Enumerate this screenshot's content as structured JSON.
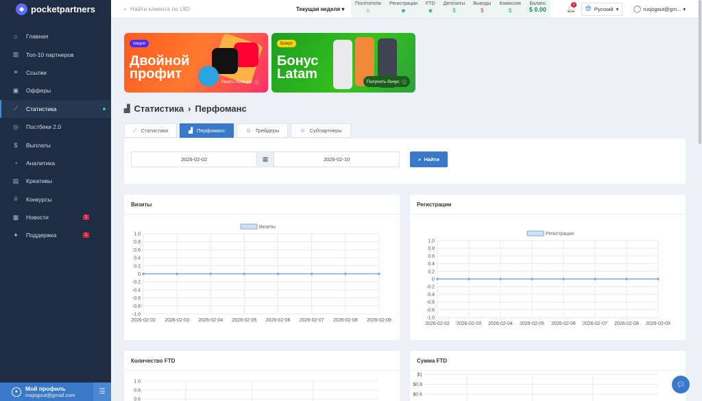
{
  "brand": {
    "name": "pocketpartners"
  },
  "topbar": {
    "search_placeholder": "Найти клиента по UID",
    "period": "Текущая неделя",
    "stats": [
      {
        "label": "Посетители",
        "value": "",
        "icon": "user-icon"
      },
      {
        "label": "Регистрации",
        "value": "",
        "icon": "users-icon"
      },
      {
        "label": "FTD",
        "value": "",
        "icon": "users-icon"
      },
      {
        "label": "Депозиты",
        "value": "$",
        "icon": "dollar-icon"
      },
      {
        "label": "Выводы",
        "value": "$",
        "icon": "dollar-icon"
      },
      {
        "label": "Комиссия",
        "value": "$",
        "icon": "dollar-icon"
      },
      {
        "label": "Баланс",
        "value": "$ 0.00",
        "icon": ""
      }
    ],
    "notifications_count": "2",
    "language": "Русский",
    "user_email": "rusjogout@gm..."
  },
  "sidebar": {
    "items": [
      {
        "label": "Главная",
        "icon": "home-icon",
        "active": false,
        "badge": ""
      },
      {
        "label": "Топ-10 партнеров",
        "icon": "bar-chart-icon",
        "active": false,
        "badge": ""
      },
      {
        "label": "Ссылки",
        "icon": "link-icon",
        "active": false,
        "badge": ""
      },
      {
        "label": "Офферы",
        "icon": "briefcase-icon",
        "active": false,
        "badge": ""
      },
      {
        "label": "Статистика",
        "icon": "line-chart-icon",
        "active": true,
        "badge": ""
      },
      {
        "label": "Постбеки 2.0",
        "icon": "globe-icon",
        "active": false,
        "badge": ""
      },
      {
        "label": "Выплаты",
        "icon": "dollar-icon",
        "active": false,
        "badge": ""
      },
      {
        "label": "Аналитика",
        "icon": "analytics-icon",
        "active": false,
        "badge": ""
      },
      {
        "label": "Креативы",
        "icon": "image-icon",
        "active": false,
        "badge": ""
      },
      {
        "label": "Конкурсы",
        "icon": "trophy-icon",
        "active": false,
        "badge": ""
      },
      {
        "label": "Новости",
        "icon": "news-icon",
        "active": false,
        "badge": "1"
      },
      {
        "label": "Поддержка",
        "icon": "support-icon",
        "active": false,
        "badge": "1"
      }
    ],
    "profile": {
      "title": "Мой профиль",
      "email": "rusjogout@gmail.com"
    }
  },
  "banners": [
    {
      "tag": "Акция",
      "title_line1": "Двойной",
      "title_line2": "профит",
      "button": "Узнать больше"
    },
    {
      "tag": "Бонус",
      "title_line1": "Бонус",
      "title_line2": "Latam",
      "button": "Получить бонус"
    }
  ],
  "page": {
    "title": "Статистика",
    "subtitle": "Перфоманс"
  },
  "tabs": [
    {
      "label": "Статистика",
      "icon": "chart-icon",
      "active": false
    },
    {
      "label": "Перфоманс",
      "icon": "area-chart-icon",
      "active": true
    },
    {
      "label": "Трейдеры",
      "icon": "user-icon",
      "active": false
    },
    {
      "label": "Субпартнеры",
      "icon": "user-icon",
      "active": false
    }
  ],
  "filter": {
    "date_from": "2026-02-02",
    "date_to": "2026-02-10",
    "find_button": "Найти"
  },
  "chart_data": [
    {
      "type": "line",
      "title": "Визиты",
      "categories": [
        "2026-02-02",
        "2026-02-03",
        "2026-02-04",
        "2026-02-05",
        "2026-02-06",
        "2026-02-07",
        "2026-02-08",
        "2026-02-09"
      ],
      "series": [
        {
          "name": "Визиты",
          "values": [
            0,
            0,
            0,
            0,
            0,
            0,
            0,
            0
          ]
        }
      ],
      "ylim": [
        -1.0,
        1.0
      ],
      "yticks": [
        "1.0",
        "0.8",
        "0.6",
        "0.4",
        "0.2",
        "0",
        "-0.2",
        "-0.4",
        "-0.6",
        "-0.8",
        "-1.0"
      ],
      "grid": true,
      "legend": "top"
    },
    {
      "type": "line",
      "title": "Регистрации",
      "categories": [
        "2026-02-02",
        "2026-02-03",
        "2026-02-04",
        "2026-02-05",
        "2026-02-06",
        "2026-02-07",
        "2026-02-08",
        "2026-02-09"
      ],
      "series": [
        {
          "name": "Регистрации",
          "values": [
            0,
            0,
            0,
            0,
            0,
            0,
            0,
            0
          ]
        }
      ],
      "ylim": [
        -1.0,
        1.0
      ],
      "yticks": [
        "1.0",
        "0.8",
        "0.6",
        "0.4",
        "0.2",
        "0",
        "-0.2",
        "-0.4",
        "-0.6",
        "-0.8",
        "-1.0"
      ],
      "grid": true,
      "legend": "top"
    },
    {
      "type": "line",
      "title": "Количество FTD",
      "categories": [],
      "series": [],
      "yticks": [
        "1.0",
        "0.8",
        "0.6"
      ],
      "grid": true
    },
    {
      "type": "line",
      "title": "Сумма FTD",
      "categories": [],
      "series": [],
      "yticks": [
        "$1",
        "$0.8",
        "$0.6"
      ],
      "grid": true
    }
  ]
}
